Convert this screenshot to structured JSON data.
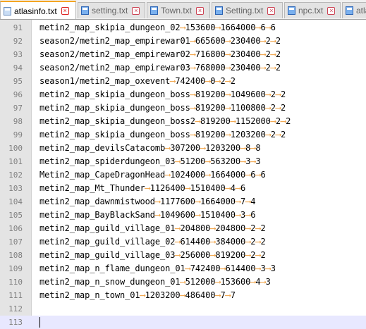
{
  "tabs": [
    {
      "label": "atlasinfo.txt",
      "active": true,
      "icon": "file-icon"
    },
    {
      "label": "setting.txt",
      "active": false,
      "icon": "file-icon"
    },
    {
      "label": "Town.txt",
      "active": false,
      "icon": "file-icon"
    },
    {
      "label": "Setting.txt",
      "active": false,
      "icon": "file-icon"
    },
    {
      "label": "npc.txt",
      "active": false,
      "icon": "file-icon"
    },
    {
      "label": "atlas",
      "active": false,
      "icon": "file-icon"
    }
  ],
  "tab_close_glyph": "×",
  "arrow_glyph": "⟶",
  "accent_color": "#f5a623",
  "tab_arrow_color": "#f0a040",
  "current_line": "113",
  "lines": [
    {
      "num": "91",
      "fields": [
        "metin2_map_skipia_dungeon_02",
        "153600",
        "1664000",
        "6",
        "6"
      ]
    },
    {
      "num": "92",
      "fields": [
        "season2/metin2_map_empirewar01",
        "665600",
        "230400",
        "2",
        "2"
      ]
    },
    {
      "num": "93",
      "fields": [
        "season2/metin2_map_empirewar02",
        "716800",
        "230400",
        "2",
        "2"
      ]
    },
    {
      "num": "94",
      "fields": [
        "season2/metin2_map_empirewar03",
        "768000",
        "230400",
        "2",
        "2"
      ]
    },
    {
      "num": "95",
      "fields": [
        "season1/metin2_map_oxevent",
        "742400",
        "0",
        "2",
        "2"
      ]
    },
    {
      "num": "96",
      "fields": [
        "metin2_map_skipia_dungeon_boss",
        "819200",
        "1049600",
        "2",
        "2"
      ]
    },
    {
      "num": "97",
      "fields": [
        "metin2_map_skipia_dungeon_boss",
        "819200",
        "1100800",
        "2",
        "2"
      ]
    },
    {
      "num": "98",
      "fields": [
        "metin2_map_skipia_dungeon_boss2",
        "819200",
        "1152000",
        "2",
        "2"
      ]
    },
    {
      "num": "99",
      "fields": [
        "metin2_map_skipia_dungeon_boss",
        "819200",
        "1203200",
        "2",
        "2"
      ]
    },
    {
      "num": "100",
      "fields": [
        "metin2_map_devilsCatacomb",
        "307200",
        "1203200",
        "8",
        "8"
      ]
    },
    {
      "num": "101",
      "fields": [
        "metin2_map_spiderdungeon_03",
        "51200",
        "563200",
        "3",
        "3"
      ]
    },
    {
      "num": "102",
      "fields": [
        "Metin2_map_CapeDragonHead",
        "1024000",
        "1664000",
        "6",
        "6"
      ]
    },
    {
      "num": "103",
      "fields": [
        "metin2_map_Mt_Thunder",
        "1126400",
        "1510400",
        "4",
        "6"
      ]
    },
    {
      "num": "104",
      "fields": [
        "metin2_map_dawnmistwood",
        "1177600",
        "1664000",
        "7",
        "4"
      ]
    },
    {
      "num": "105",
      "fields": [
        "metin2_map_BayBlackSand",
        "1049600",
        "1510400",
        "3",
        "6"
      ]
    },
    {
      "num": "106",
      "fields": [
        "metin2_map_guild_village_01",
        "204800",
        "204800",
        "2",
        "2"
      ]
    },
    {
      "num": "107",
      "fields": [
        "metin2_map_guild_village_02",
        "614400",
        "384000",
        "2",
        "2"
      ]
    },
    {
      "num": "108",
      "fields": [
        "metin2_map_guild_village_03",
        "256000",
        "819200",
        "2",
        "2"
      ]
    },
    {
      "num": "109",
      "fields": [
        "metin2_map_n_flame_dungeon_01",
        "742400",
        "614400",
        "3",
        "3"
      ]
    },
    {
      "num": "110",
      "fields": [
        "metin2_map_n_snow_dungeon_01",
        "512000",
        "153600",
        "4",
        "3"
      ]
    },
    {
      "num": "111",
      "fields": [
        "metin2_map_n_town_01",
        "1203200",
        "486400",
        "7",
        "7"
      ]
    },
    {
      "num": "112",
      "fields": []
    },
    {
      "num": "113",
      "fields": []
    }
  ]
}
